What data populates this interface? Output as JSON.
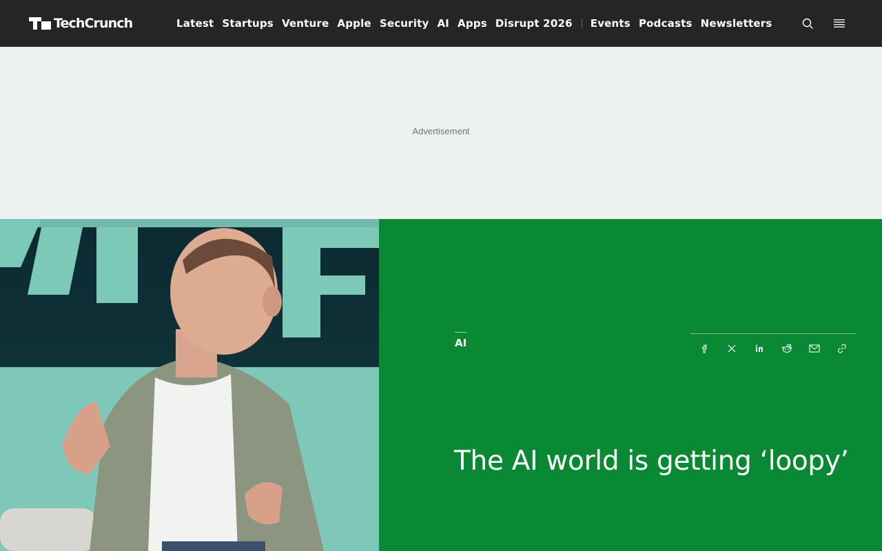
{
  "brand": {
    "name": "TechCrunch",
    "logo_icon": "techcrunch-logo-icon"
  },
  "nav": {
    "primary": [
      "Latest",
      "Startups",
      "Venture",
      "Apple",
      "Security",
      "AI",
      "Apps",
      "Disrupt 2026"
    ],
    "secondary": [
      "Events",
      "Podcasts",
      "Newsletters"
    ]
  },
  "header_icons": {
    "search": "search-icon",
    "menu": "hamburger-menu-icon"
  },
  "ad": {
    "label": "Advertisement"
  },
  "article": {
    "category": "AI",
    "title": "The AI world is getting ‘loopy’",
    "share_icons": [
      "facebook-icon",
      "x-icon",
      "linkedin-icon",
      "reddit-icon",
      "email-icon",
      "link-icon"
    ]
  },
  "colors": {
    "header_bg": "#232624",
    "ad_bg": "#edf1f0",
    "hero_green": "#0a8935",
    "text_white": "#ffffff"
  }
}
